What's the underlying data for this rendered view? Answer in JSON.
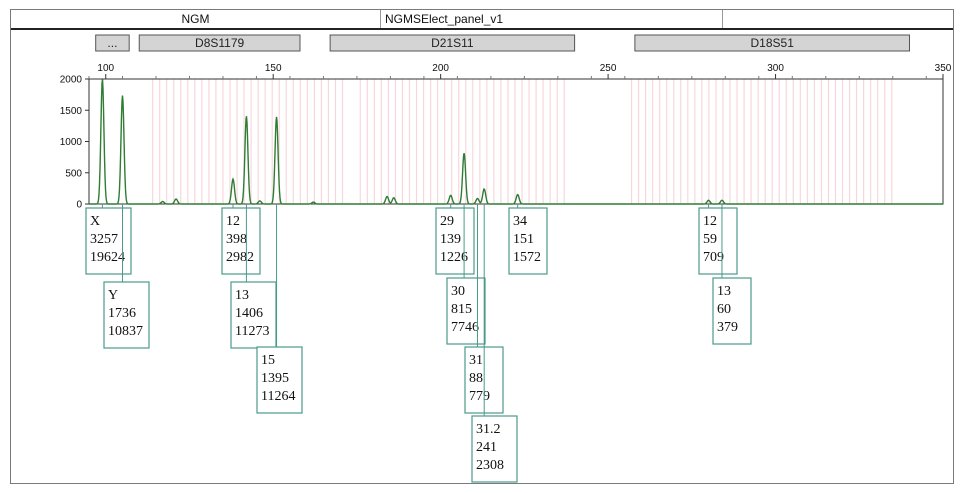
{
  "header": {
    "kit": "NGM",
    "panel": "NGMSElect_panel_v1",
    "extra": ""
  },
  "colors": {
    "trace": "#2e7d32",
    "bin_stripe": "#f2b8c2",
    "marker_bar": "#d4d4d4",
    "call_border": "#4a9a8a"
  },
  "chart_data": {
    "type": "line",
    "title": "",
    "xlabel": "",
    "ylabel": "",
    "xlim": [
      95,
      350
    ],
    "ylim": [
      0,
      2000
    ],
    "x_ticks": [
      100,
      150,
      200,
      250,
      300,
      350
    ],
    "y_ticks": [
      0,
      500,
      1000,
      1500,
      2000
    ],
    "markers": [
      {
        "label": "...",
        "start": 97,
        "end": 107,
        "interactable": true
      },
      {
        "label": "D8S1179",
        "start": 110,
        "end": 158
      },
      {
        "label": "D21S11",
        "start": 167,
        "end": 240
      },
      {
        "label": "D18S51",
        "start": 258,
        "end": 340
      }
    ],
    "bin_regions": [
      {
        "start": 114,
        "end": 172
      },
      {
        "start": 176,
        "end": 238
      },
      {
        "start": 257,
        "end": 336
      }
    ],
    "peaks": [
      {
        "x": 99,
        "height": 2000
      },
      {
        "x": 105,
        "height": 1736
      },
      {
        "x": 117,
        "height": 40
      },
      {
        "x": 121,
        "height": 80
      },
      {
        "x": 138,
        "height": 398
      },
      {
        "x": 142,
        "height": 1406
      },
      {
        "x": 146,
        "height": 50
      },
      {
        "x": 151,
        "height": 1395
      },
      {
        "x": 162,
        "height": 30
      },
      {
        "x": 184,
        "height": 120
      },
      {
        "x": 186,
        "height": 100
      },
      {
        "x": 203,
        "height": 139
      },
      {
        "x": 207,
        "height": 815
      },
      {
        "x": 211,
        "height": 88
      },
      {
        "x": 213,
        "height": 241
      },
      {
        "x": 223,
        "height": 151
      },
      {
        "x": 280,
        "height": 59
      },
      {
        "x": 284,
        "height": 60
      }
    ],
    "calls": [
      {
        "allele": "X",
        "height": "3257",
        "area": "19624",
        "peak_x": 99
      },
      {
        "allele": "Y",
        "height": "1736",
        "area": "10837",
        "peak_x": 105
      },
      {
        "allele": "12",
        "height": "398",
        "area": "2982",
        "peak_x": 138
      },
      {
        "allele": "13",
        "height": "1406",
        "area": "11273",
        "peak_x": 142
      },
      {
        "allele": "15",
        "height": "1395",
        "area": "11264",
        "peak_x": 151
      },
      {
        "allele": "29",
        "height": "139",
        "area": "1226",
        "peak_x": 203
      },
      {
        "allele": "30",
        "height": "815",
        "area": "7746",
        "peak_x": 207
      },
      {
        "allele": "31",
        "height": "88",
        "area": "779",
        "peak_x": 211
      },
      {
        "allele": "31.2",
        "height": "241",
        "area": "2308",
        "peak_x": 213
      },
      {
        "allele": "34",
        "height": "151",
        "area": "1572",
        "peak_x": 223
      },
      {
        "allele": "12",
        "height": "59",
        "area": "709",
        "peak_x": 280
      },
      {
        "allele": "13",
        "height": "60",
        "area": "379",
        "peak_x": 284
      }
    ]
  }
}
